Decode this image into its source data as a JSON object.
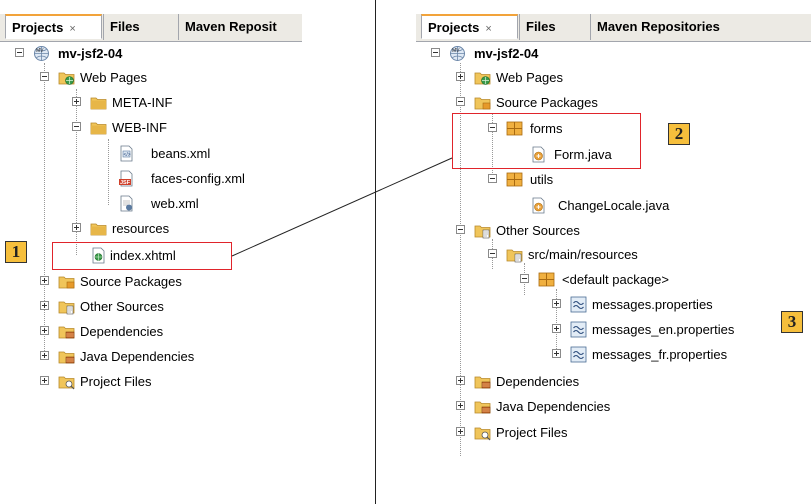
{
  "left": {
    "tabs": {
      "projects": "Projects",
      "close": "×",
      "files": "Files",
      "maven": "Maven Reposit"
    },
    "tree": {
      "root": "mv-jsf2-04",
      "web_pages": "Web Pages",
      "meta_inf": "META-INF",
      "web_inf": "WEB-INF",
      "beans": "beans.xml",
      "faces_config": "faces-config.xml",
      "web_xml": "web.xml",
      "resources": "resources",
      "index": "index.xhtml",
      "source_packages": "Source Packages",
      "other_sources": "Other Sources",
      "dependencies": "Dependencies",
      "java_dependencies": "Java Dependencies",
      "project_files": "Project Files"
    }
  },
  "right": {
    "tabs": {
      "projects": "Projects",
      "close": "×",
      "files": "Files",
      "maven": "Maven Repositories"
    },
    "tree": {
      "root": "mv-jsf2-04",
      "web_pages": "Web Pages",
      "source_packages": "Source Packages",
      "forms": "forms",
      "form_java": "Form.java",
      "utils": "utils",
      "change_locale": "ChangeLocale.java",
      "other_sources": "Other Sources",
      "src_main_resources": "src/main/resources",
      "default_package": "<default package>",
      "messages": "messages.properties",
      "messages_en": "messages_en.properties",
      "messages_fr": "messages_fr.properties",
      "dependencies": "Dependencies",
      "java_dependencies": "Java Dependencies",
      "project_files": "Project Files"
    }
  },
  "badges": {
    "one": "1",
    "two": "2",
    "three": "3"
  },
  "colors": {
    "highlight": "#e0242b",
    "badge": "#f6bf3c",
    "folder": "#e8b84a",
    "package": "#e0a030"
  }
}
